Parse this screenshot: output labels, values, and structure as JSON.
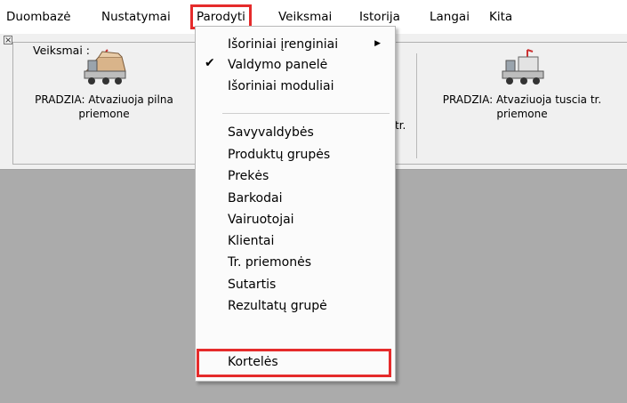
{
  "menubar": {
    "items": [
      {
        "label": "Duombazė"
      },
      {
        "label": "Nustatymai"
      },
      {
        "label": "Parodyti"
      },
      {
        "label": "Veiksmai"
      },
      {
        "label": "Istorija"
      },
      {
        "label": "Langai"
      },
      {
        "label": "Kita"
      }
    ]
  },
  "toolbar": {
    "group_title": "Veiksmai :",
    "buttons": [
      {
        "label": "PRADZIA:  Atvaziuoja pilna priemone",
        "icon": "loaded-truck-icon"
      },
      {
        "label": "PRADZIA: Atvaziuoja tuscia tr. priemone",
        "icon": "empty-truck-icon"
      }
    ],
    "partial_label": "tr."
  },
  "menu": {
    "items": [
      {
        "label": "Išoriniai įrenginiai",
        "submenu": true
      },
      {
        "label": "Valdymo panelė",
        "checked": true
      },
      {
        "label": "Išoriniai moduliai"
      },
      {
        "label": "Savyvaldybės"
      },
      {
        "label": "Produktų grupės"
      },
      {
        "label": "Prekės"
      },
      {
        "label": "Barkodai"
      },
      {
        "label": "Vairuotojai"
      },
      {
        "label": "Klientai"
      },
      {
        "label": "Tr. priemonės"
      },
      {
        "label": "Sutartis"
      },
      {
        "label": "Rezultatų grupė"
      },
      {
        "label": "Kortelės",
        "highlighted": true
      }
    ]
  },
  "colors": {
    "highlight": "#e52b2b",
    "workspace": "#ababab"
  }
}
